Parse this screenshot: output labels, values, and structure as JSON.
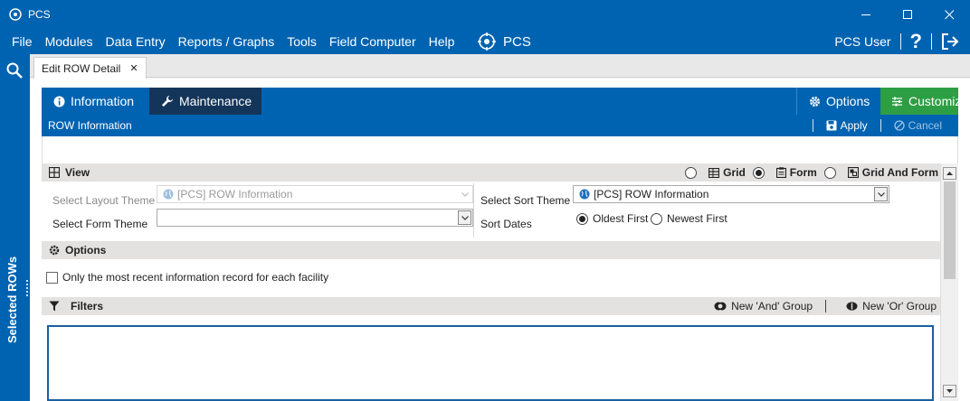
{
  "window": {
    "title": "PCS",
    "controls": [
      "minimize-icon",
      "maximize-icon",
      "close-icon"
    ]
  },
  "menu": {
    "items": [
      "File",
      "Modules",
      "Data Entry",
      "Reports / Graphs",
      "Tools",
      "Field Computer",
      "Help"
    ],
    "brand": "PCS",
    "user": "PCS User",
    "help": "?"
  },
  "sidebar": {
    "label": "Selected ROWs"
  },
  "doc_tab": {
    "label": "Edit ROW Detail",
    "close": "✕"
  },
  "nav": {
    "info_label": "Information",
    "maint_label": "Maintenance",
    "options_label": "Options",
    "customize_label": "Customize"
  },
  "subbar": {
    "title": "ROW Information",
    "apply_label": "Apply",
    "cancel_label": "Cancel"
  },
  "view": {
    "header": "View",
    "modes": [
      "Grid",
      "Form",
      "Grid And Form"
    ],
    "selected_mode": "Form"
  },
  "form": {
    "layout_theme_label": "Select Layout Theme",
    "layout_theme_value": "[PCS] ROW Information",
    "form_theme_label": "Select Form Theme",
    "form_theme_value": "",
    "sort_theme_label": "Select Sort Theme",
    "sort_theme_value": "[PCS] ROW Information",
    "sort_dates_label": "Sort Dates",
    "sort_dates_options": [
      "Oldest First",
      "Newest First"
    ],
    "sort_dates_selected": "Oldest First"
  },
  "options": {
    "header": "Options",
    "recent_only_label": "Only the most recent information record for each facility",
    "recent_only_checked": false
  },
  "filters": {
    "header": "Filters",
    "and_group_label": "New 'And' Group",
    "or_group_label": "New 'Or' Group"
  },
  "colors": {
    "primary": "#0063b1",
    "maintenance_tab": "#14355a",
    "customize": "#2e9e44",
    "section_header": "#e4e1e1"
  }
}
